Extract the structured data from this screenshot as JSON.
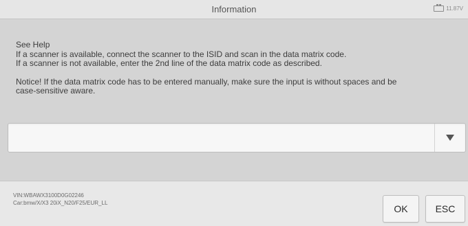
{
  "window": {
    "title": "Information",
    "battery_voltage": "11.87V"
  },
  "help": {
    "heading": "See Help",
    "line1": " If a scanner is available, connect the scanner to the ISID and scan in the data matrix code.",
    "line2": " If a scanner is not available, enter the 2nd line of the data matrix code as described.",
    "notice_line1": "Notice! If the data matrix code has to be entered manually, make sure the input is without spaces and be",
    "notice_line2": "case-sensitive aware."
  },
  "input": {
    "value": "",
    "placeholder": ""
  },
  "vehicle": {
    "vin": "VIN:WBAWX3100D0G02246",
    "car": "Car:bmw/X/X3 20iX_N20/F25/EUR_LL"
  },
  "buttons": {
    "ok_label": "OK",
    "esc_label": "ESC"
  },
  "icons": {
    "battery": "battery-icon",
    "dropdown": "triangle-down-icon"
  },
  "colors": {
    "background": "#d4d4d4",
    "titlebar": "#e6e6e6",
    "footer": "#e8e8e8",
    "input_bg": "#f7f7f7",
    "button_bg": "#f4f4f4"
  }
}
